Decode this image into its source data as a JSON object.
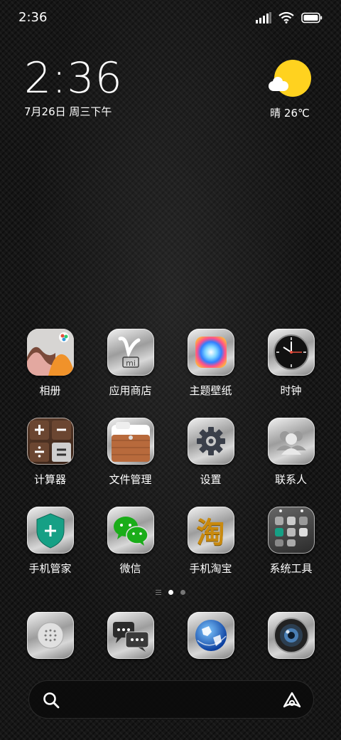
{
  "status_bar": {
    "time": "2:36",
    "icons": [
      "signal-icon",
      "wifi-icon",
      "battery-icon"
    ]
  },
  "clock_widget": {
    "time": "2:36",
    "date": "7月26日 周三下午"
  },
  "weather": {
    "text": "晴 26℃",
    "icon": "sunny-cloud-icon"
  },
  "apps": [
    {
      "label": "相册",
      "icon": "gallery-icon"
    },
    {
      "label": "应用商店",
      "icon": "app-store-icon"
    },
    {
      "label": "主题壁纸",
      "icon": "themes-icon"
    },
    {
      "label": "时钟",
      "icon": "clock-icon"
    },
    {
      "label": "计算器",
      "icon": "calculator-icon"
    },
    {
      "label": "文件管理",
      "icon": "file-manager-icon"
    },
    {
      "label": "设置",
      "icon": "settings-gear-icon"
    },
    {
      "label": "联系人",
      "icon": "contacts-icon"
    },
    {
      "label": "手机管家",
      "icon": "security-shield-icon"
    },
    {
      "label": "微信",
      "icon": "wechat-icon"
    },
    {
      "label": "手机淘宝",
      "icon": "taobao-icon"
    },
    {
      "label": "系统工具",
      "icon": "system-tools-folder-icon"
    }
  ],
  "taobao_glyph": "淘",
  "page_indicator": {
    "pages": 2,
    "current": 1
  },
  "dock": [
    {
      "icon": "phone-dialer-icon"
    },
    {
      "icon": "messages-icon"
    },
    {
      "icon": "browser-globe-icon"
    },
    {
      "icon": "camera-icon"
    }
  ],
  "search_bar": {
    "icon": "search-icon",
    "assistant_icon": "assistant-icon"
  },
  "colors": {
    "weather_sun": "#ffd21f",
    "accent_green": "#1aad19",
    "shield_green": "#16a085"
  }
}
